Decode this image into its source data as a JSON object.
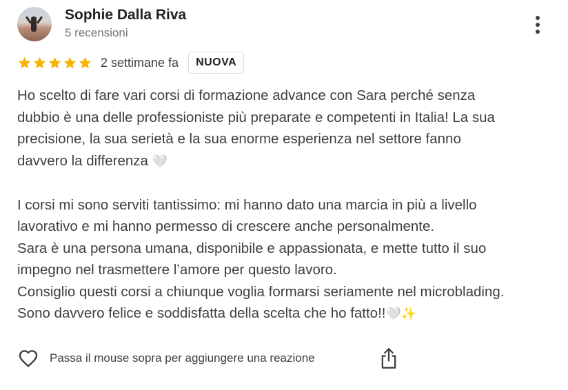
{
  "reviewer": {
    "name": "Sophie Dalla Riva",
    "reviews_count": "5 recensioni",
    "avatar_icon": "profile-photo"
  },
  "rating": {
    "stars": 5,
    "max": 5,
    "color": "#f4b400"
  },
  "date": "2 settimane fa",
  "badge": "NUOVA",
  "review": {
    "lines": [
      "Ho scelto di fare vari corsi di formazione advance con Sara perché senza",
      "dubbio è una delle professioniste più preparate e competenti in Italia! La sua",
      "precisione, la sua serietà e la sua enorme esperienza nel settore fanno",
      "davvero la differenza",
      "",
      "I corsi mi sono serviti tantissimo: mi hanno dato una marcia in più a livello",
      "lavorativo e mi hanno permesso di crescere anche personalmente.",
      "Sara è una persona umana, disponibile e appassionata, e mette tutto il suo",
      "impegno nel trasmettere l’amore per questo lavoro.",
      "Consiglio questi corsi a chiunque voglia formarsi seriamente nel microblading.",
      "Sono davvero felice e soddisfatta della scelta che ho fatto!!"
    ],
    "emoji_heart": "🤍",
    "emoji_sparkles": "✨"
  },
  "footer": {
    "reaction_text": "Passa il mouse sopra per aggiungere una reazione",
    "reaction_icon": "heart-outline-icon",
    "share_icon": "share-icon"
  },
  "menu_icon": "more-vertical-icon"
}
